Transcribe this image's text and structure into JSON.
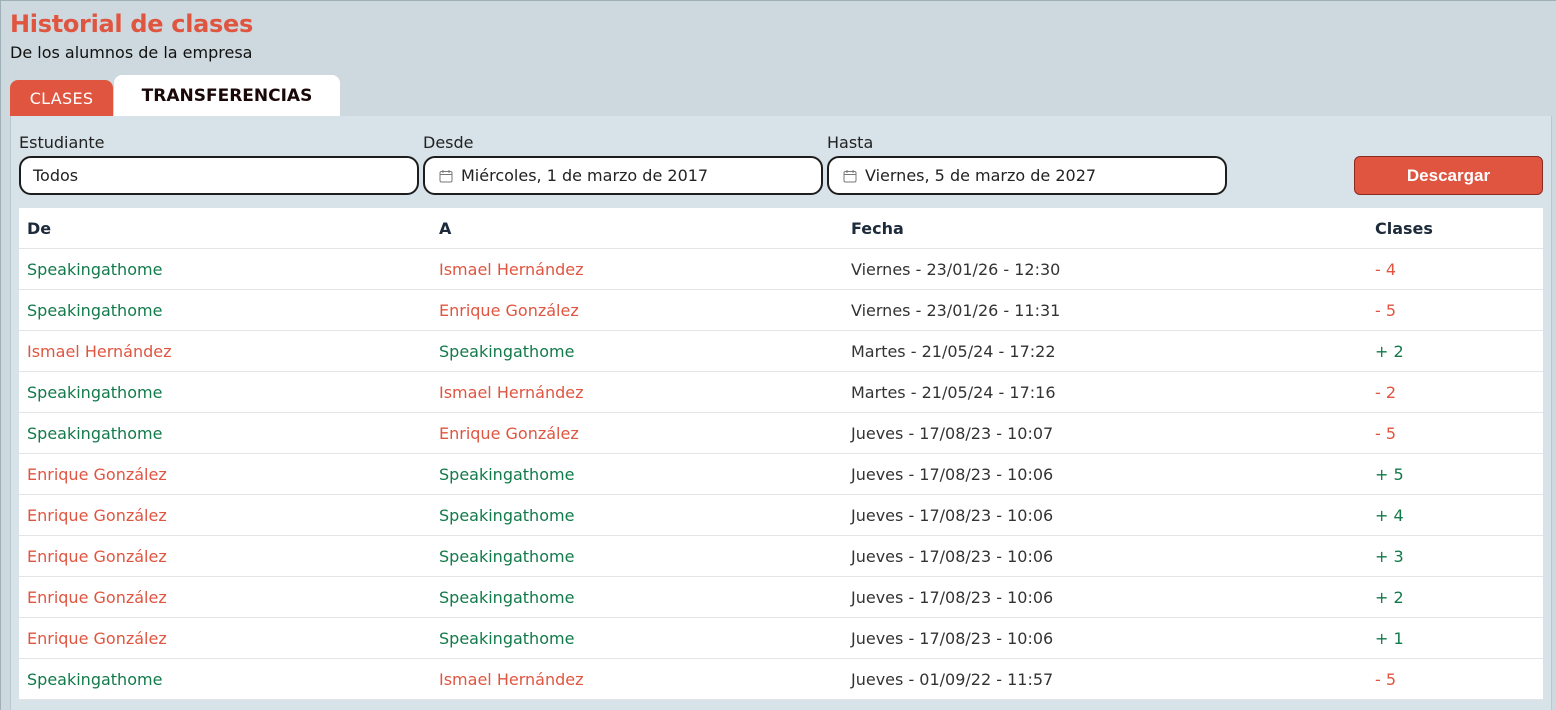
{
  "header": {
    "title": "Historial de clases",
    "subtitle": "De los alumnos de la empresa"
  },
  "tabs": [
    {
      "label": "CLASES",
      "active": false
    },
    {
      "label": "TRANSFERENCIAS",
      "active": true
    }
  ],
  "filters": {
    "student_label": "Estudiante",
    "student_value": "Todos",
    "from_label": "Desde",
    "from_value": "Miércoles, 1 de marzo de 2017",
    "to_label": "Hasta",
    "to_value": "Viernes, 5 de marzo de 2027",
    "download_label": "Descargar",
    "calendar_icon": "calendar-icon"
  },
  "colors": {
    "accent": "#e05540",
    "positive": "#127a4a",
    "background": "#cdd9de"
  },
  "table": {
    "columns": [
      "De",
      "A",
      "Fecha",
      "Clases"
    ],
    "rows": [
      {
        "de": "Speakingathome",
        "de_color": "green",
        "a": "Ismael Hernández",
        "a_color": "red",
        "fecha": "Viernes - 23/01/26 - 12:30",
        "clases": "- 4",
        "clases_color": "red"
      },
      {
        "de": "Speakingathome",
        "de_color": "green",
        "a": "Enrique González",
        "a_color": "red",
        "fecha": "Viernes - 23/01/26 - 11:31",
        "clases": "- 5",
        "clases_color": "red"
      },
      {
        "de": "Ismael Hernández",
        "de_color": "red",
        "a": "Speakingathome",
        "a_color": "green",
        "fecha": "Martes - 21/05/24 - 17:22",
        "clases": "+ 2",
        "clases_color": "green"
      },
      {
        "de": "Speakingathome",
        "de_color": "green",
        "a": "Ismael Hernández",
        "a_color": "red",
        "fecha": "Martes - 21/05/24 - 17:16",
        "clases": "- 2",
        "clases_color": "red"
      },
      {
        "de": "Speakingathome",
        "de_color": "green",
        "a": "Enrique González",
        "a_color": "red",
        "fecha": "Jueves - 17/08/23 - 10:07",
        "clases": "- 5",
        "clases_color": "red"
      },
      {
        "de": "Enrique González",
        "de_color": "red",
        "a": "Speakingathome",
        "a_color": "green",
        "fecha": "Jueves - 17/08/23 - 10:06",
        "clases": "+ 5",
        "clases_color": "green"
      },
      {
        "de": "Enrique González",
        "de_color": "red",
        "a": "Speakingathome",
        "a_color": "green",
        "fecha": "Jueves - 17/08/23 - 10:06",
        "clases": "+ 4",
        "clases_color": "green"
      },
      {
        "de": "Enrique González",
        "de_color": "red",
        "a": "Speakingathome",
        "a_color": "green",
        "fecha": "Jueves - 17/08/23 - 10:06",
        "clases": "+ 3",
        "clases_color": "green"
      },
      {
        "de": "Enrique González",
        "de_color": "red",
        "a": "Speakingathome",
        "a_color": "green",
        "fecha": "Jueves - 17/08/23 - 10:06",
        "clases": "+ 2",
        "clases_color": "green"
      },
      {
        "de": "Enrique González",
        "de_color": "red",
        "a": "Speakingathome",
        "a_color": "green",
        "fecha": "Jueves - 17/08/23 - 10:06",
        "clases": "+ 1",
        "clases_color": "green"
      },
      {
        "de": "Speakingathome",
        "de_color": "green",
        "a": "Ismael Hernández",
        "a_color": "red",
        "fecha": "Jueves - 01/09/22 - 11:57",
        "clases": "- 5",
        "clases_color": "red"
      }
    ]
  }
}
